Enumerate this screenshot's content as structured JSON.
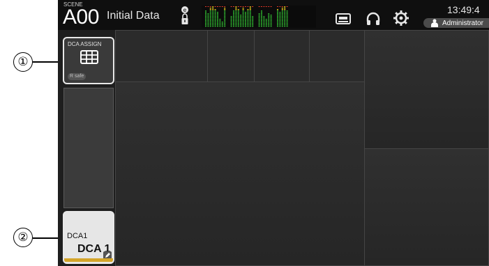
{
  "callouts": [
    {
      "label": "①"
    },
    {
      "label": "②"
    }
  ],
  "topbar": {
    "scene_label": "SCENE",
    "scene_number": "A00",
    "scene_title": "Initial Data",
    "clock": "13:49:4",
    "user": "Administrator"
  },
  "dca_assign": {
    "label": "DCA ASSIGN",
    "recall_safe": "R safe"
  },
  "dca_channel": {
    "number": "DCA1",
    "name": "DCA 1",
    "color": "#d4a52a"
  },
  "icons": [
    "lock-icon",
    "recorder-icon",
    "headphone-icon",
    "gear-icon",
    "person-icon",
    "grid-icon",
    "edit-icon"
  ],
  "colors": {
    "screen_bg": "#2a2a2a",
    "topbar_bg": "#0f0f0f",
    "meter_green": "#2fb02f",
    "meter_yellow": "#e0c81e",
    "meter_red": "#e03a2a"
  }
}
